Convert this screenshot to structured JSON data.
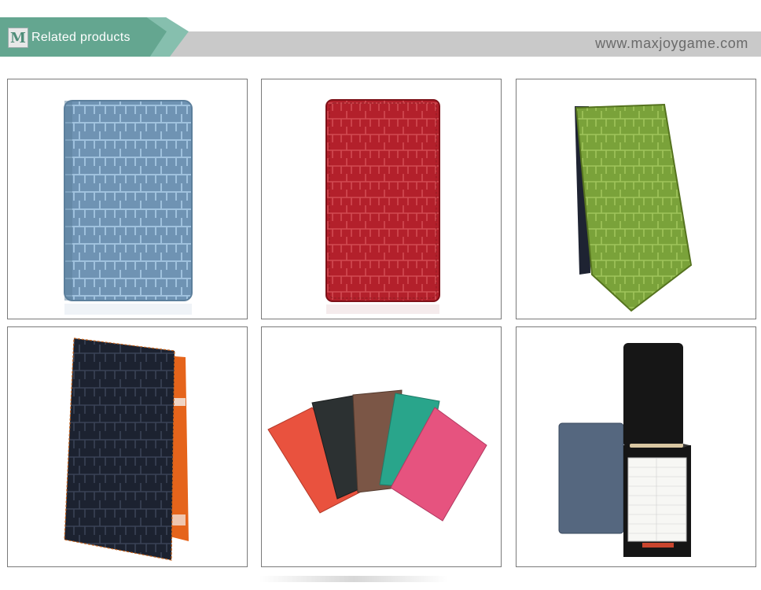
{
  "header": {
    "logo_letter": "M",
    "title": "Related products",
    "website": "www.maxjoygame.com",
    "accent_color": "#64a690",
    "band_color": "#c9c9c9"
  },
  "products": [
    {
      "name": "blue-croc-notebook-cover",
      "color": "#6f93b3"
    },
    {
      "name": "red-croc-scorecard-holder",
      "color": "#b3202b"
    },
    {
      "name": "green-croc-scorecard-holder",
      "color": "#7aa23a"
    },
    {
      "name": "black-croc-holder-orange-lining",
      "color": "#1c2230"
    },
    {
      "name": "multicolor-croc-covers-fan",
      "color": "#e6537f"
    },
    {
      "name": "scorecard-holder-with-card-and-pencil",
      "color": "#222222"
    }
  ]
}
